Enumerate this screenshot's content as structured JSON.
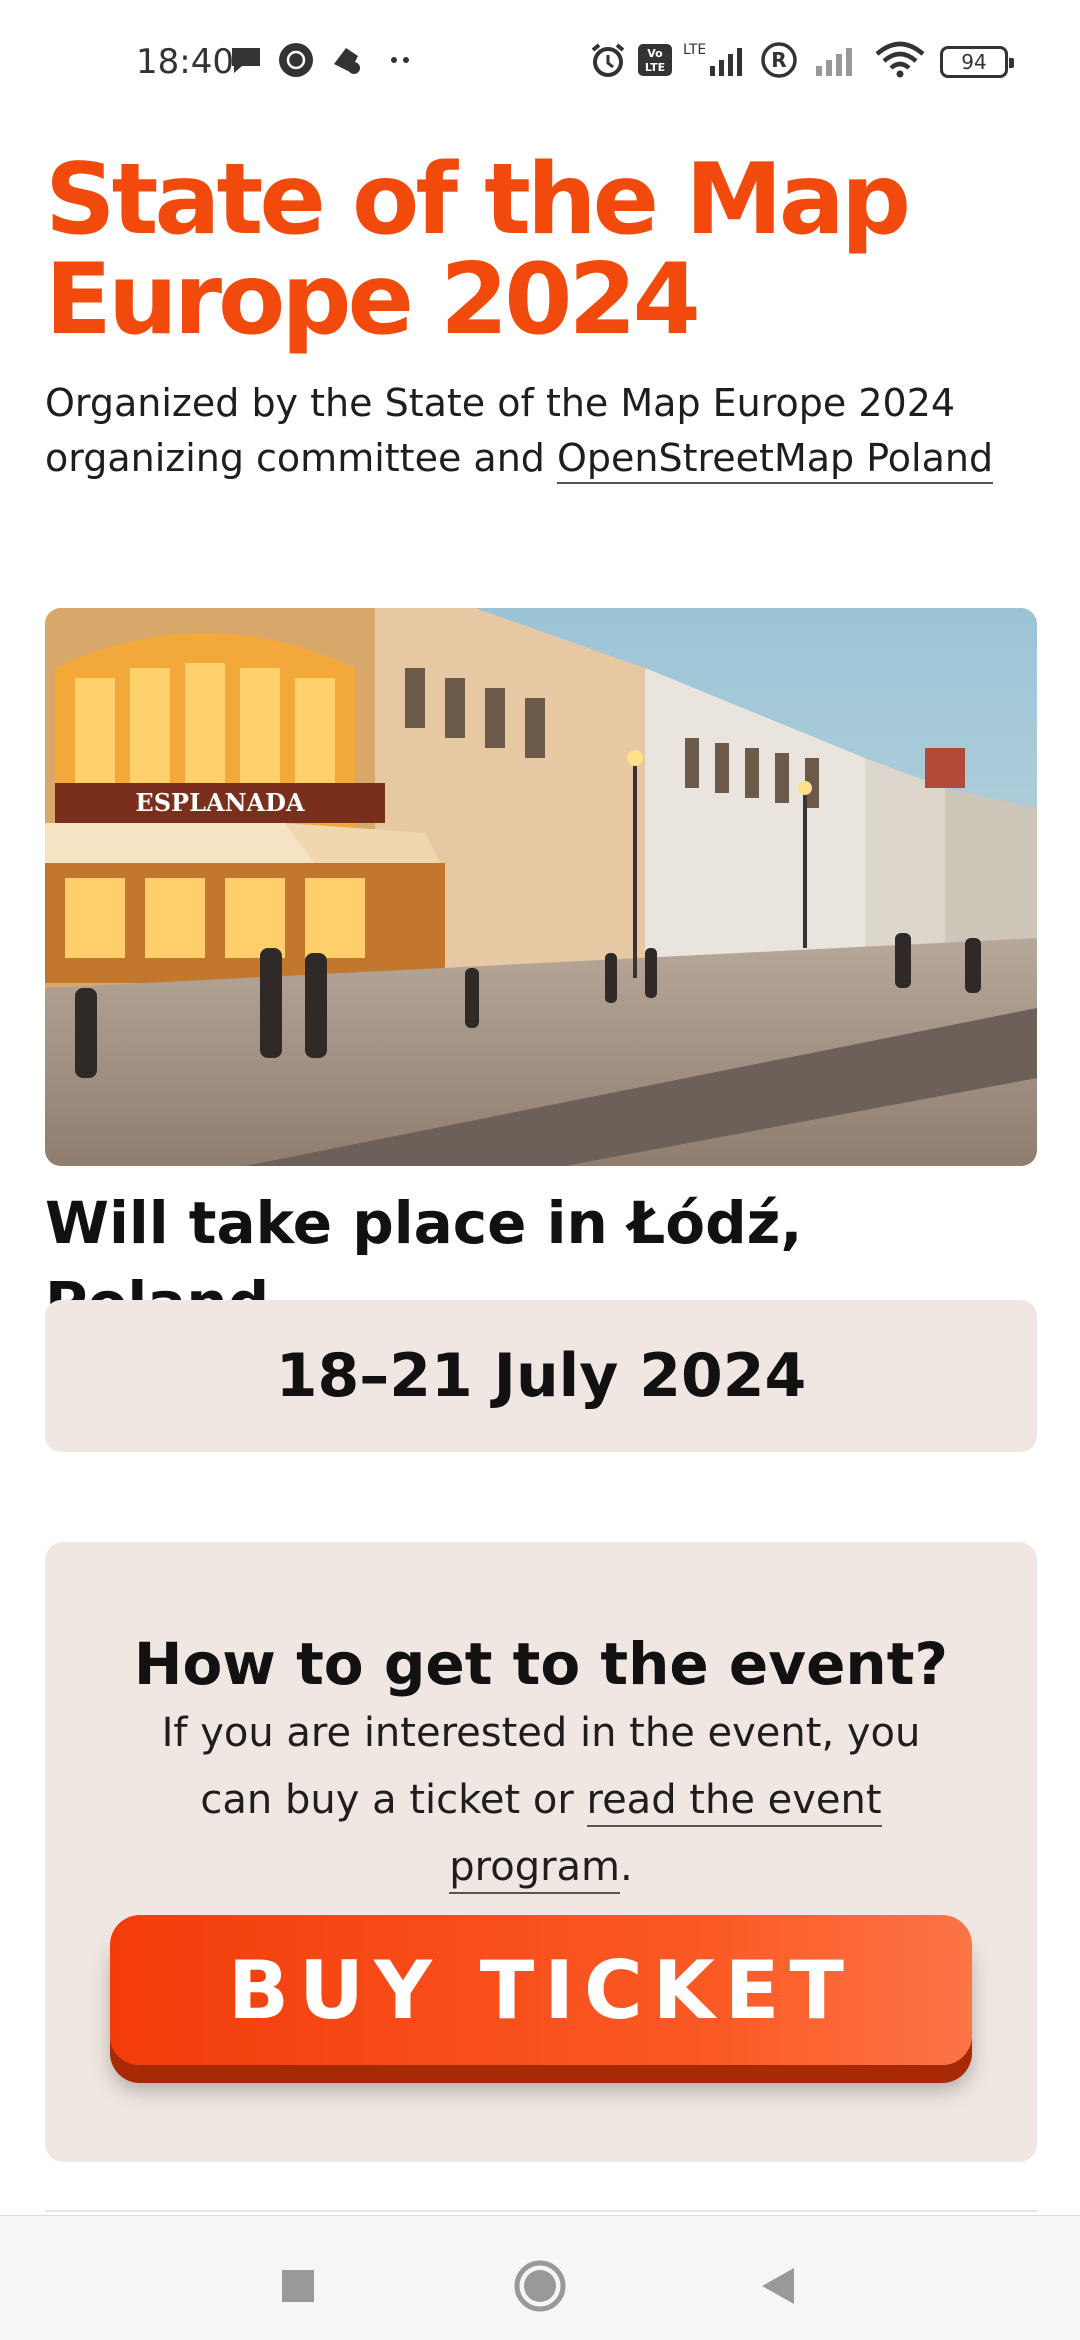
{
  "status_bar": {
    "time": "18:40",
    "icons": [
      "message-icon",
      "notification-icon",
      "app-icon",
      "more-dots-icon",
      "alarm-icon",
      "volte-icon",
      "lte-signal-icon",
      "registered-icon",
      "signal-icon",
      "wifi-icon",
      "battery-icon"
    ],
    "lte_label": "LTE",
    "volte_label": "Vo LTE",
    "battery": "94"
  },
  "header": {
    "title_line1": "State of the Map",
    "title_line2": "Europe 2024",
    "organizer_text": "Organized by the State of the Map Europe 2024 organizing committee and ",
    "organizer_link": "OpenStreetMap Poland"
  },
  "photo": {
    "alt_icon": "city-street-photo",
    "sign_text": "ESPLANADA"
  },
  "location": {
    "text": "Will take place in Łódź, Poland"
  },
  "date": {
    "text": "18–21 July 2024"
  },
  "event_card": {
    "heading": "How to get to the event?",
    "body_prefix": "If you are interested in the event, you can buy a ticket or ",
    "body_link": "read the event program",
    "body_suffix": ".",
    "button_label": "BUY TICKET"
  },
  "nav": {
    "items": [
      "recents-button",
      "home-button",
      "back-button"
    ]
  },
  "colors": {
    "accent": "#f24a0c",
    "card_bg": "#f1e7e2",
    "button_shadow": "#a72a04"
  }
}
